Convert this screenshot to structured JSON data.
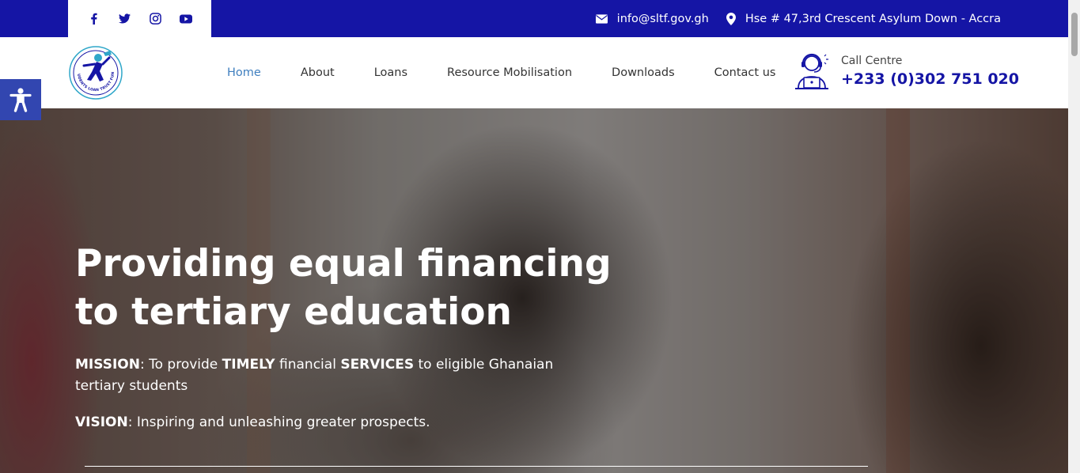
{
  "topbar": {
    "social": [
      "facebook-icon",
      "twitter-icon",
      "instagram-icon",
      "youtube-icon"
    ],
    "email": "info@sltf.gov.gh",
    "address": "Hse # 47,3rd Crescent Asylum Down - Accra"
  },
  "header": {
    "logo_text": "STUDENTS LOAN TRUST FUND",
    "nav": {
      "home": "Home",
      "about": "About",
      "loans": "Loans",
      "resource": "Resource Mobilisation",
      "downloads": "Downloads",
      "contact": "Contact us"
    },
    "call_label": "Call Centre",
    "call_phone": "+233 (0)302 751 020"
  },
  "hero": {
    "title": "Providing equal financing to tertiary education",
    "mission_label": "MISSION",
    "mission_p1": ": To provide ",
    "mission_b1": "TIMELY",
    "mission_p2": " financial ",
    "mission_b2": "SERVICES",
    "mission_p3": " to eligible Ghanaian tertiary students",
    "vision_label": "VISION",
    "vision_text": ": Inspiring and unleashing greater prospects."
  },
  "colors": {
    "brand_blue": "#1515a5",
    "nav_active": "#3f7fbf",
    "accessibility": "#3246b0"
  }
}
